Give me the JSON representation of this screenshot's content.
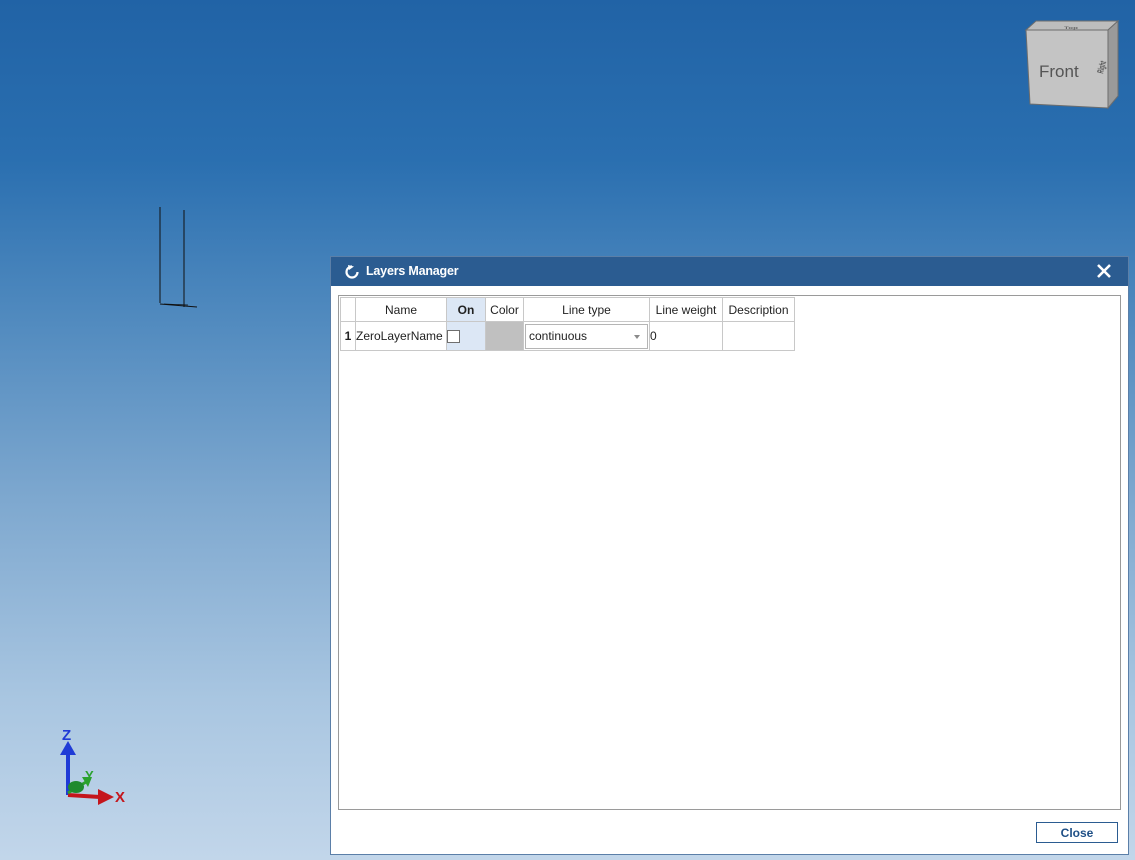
{
  "viewport": {
    "view_cube": {
      "front_label": "Front",
      "right_label": "Right",
      "top_label": "Top"
    },
    "axis_triad": {
      "x_label": "X",
      "y_label": "Y",
      "z_label": "Z"
    }
  },
  "dialog": {
    "title": "Layers Manager",
    "icon": "refresh-icon",
    "close_icon": "close-icon",
    "grid": {
      "columns": [
        {
          "key": "name",
          "label": "Name"
        },
        {
          "key": "on",
          "label": "On"
        },
        {
          "key": "color",
          "label": "Color"
        },
        {
          "key": "linetype",
          "label": "Line type"
        },
        {
          "key": "lineweight",
          "label": "Line weight"
        },
        {
          "key": "description",
          "label": "Description"
        }
      ],
      "rows": [
        {
          "index": "1",
          "name": "ZeroLayerName",
          "on": false,
          "color": "#c0c0c0",
          "linetype": "continuous",
          "lineweight": "0",
          "description": ""
        }
      ]
    },
    "close_button_label": "Close"
  },
  "colors": {
    "titlebar": "#2b5c91",
    "viewport_top": "#2163a6",
    "viewport_bottom": "#c2d6ea",
    "sorted_column": "#dce7f5"
  }
}
